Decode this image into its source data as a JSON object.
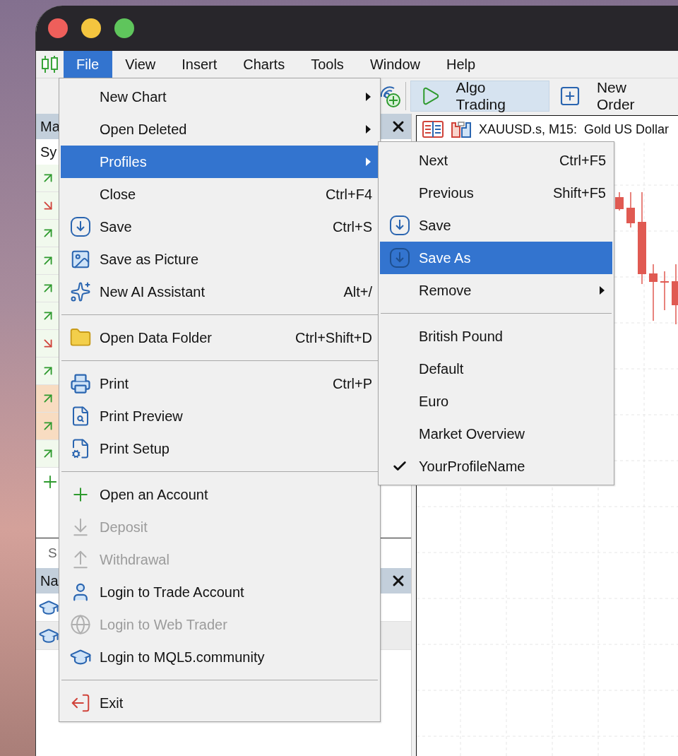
{
  "menu_bar": {
    "items": [
      {
        "label": "File",
        "selected": true
      },
      {
        "label": "View",
        "selected": false
      },
      {
        "label": "Insert",
        "selected": false
      },
      {
        "label": "Charts",
        "selected": false
      },
      {
        "label": "Tools",
        "selected": false
      },
      {
        "label": "Window",
        "selected": false
      },
      {
        "label": "Help",
        "selected": false
      }
    ]
  },
  "toolbar": {
    "buttons": [
      {
        "label": "Algo Trading",
        "active": true
      },
      {
        "label": "New Order",
        "active": false
      }
    ]
  },
  "market_watch": {
    "title": "Ma",
    "column": "Sy",
    "rows": [
      {
        "kind": "up",
        "highlighted": false
      },
      {
        "kind": "down",
        "highlighted": false
      },
      {
        "kind": "up",
        "highlighted": false
      },
      {
        "kind": "up",
        "highlighted": false
      },
      {
        "kind": "up",
        "highlighted": false
      },
      {
        "kind": "up",
        "highlighted": false
      },
      {
        "kind": "down",
        "highlighted": false
      },
      {
        "kind": "up",
        "highlighted": false
      },
      {
        "kind": "up",
        "highlighted": true
      },
      {
        "kind": "up",
        "highlighted": true
      },
      {
        "kind": "up",
        "highlighted": false
      }
    ]
  },
  "bottom_tab": "S",
  "navigator": {
    "title": "Na",
    "items": [
      {
        "selected": false
      },
      {
        "selected": true
      }
    ]
  },
  "chart": {
    "title": "XAUUSD.s, M15:  Gold US Dollar"
  },
  "file_menu": {
    "items": [
      {
        "kind": "item",
        "label": "New Chart",
        "submenu": true,
        "selected": false,
        "disabled": false
      },
      {
        "kind": "item",
        "label": "Open Deleted",
        "submenu": true,
        "selected": false,
        "disabled": false
      },
      {
        "kind": "item",
        "label": "Profiles",
        "submenu": true,
        "selected": true,
        "disabled": false
      },
      {
        "kind": "item",
        "label": "Close",
        "shortcut": "Ctrl+F4",
        "selected": false,
        "disabled": false
      },
      {
        "kind": "item",
        "label": "Save",
        "shortcut": "Ctrl+S",
        "selected": false,
        "disabled": false
      },
      {
        "kind": "item",
        "label": "Save as Picture",
        "selected": false,
        "disabled": false
      },
      {
        "kind": "item",
        "label": "New AI Assistant",
        "shortcut": "Alt+/",
        "selected": false,
        "disabled": false
      },
      {
        "kind": "separator"
      },
      {
        "kind": "item",
        "label": "Open Data Folder",
        "shortcut": "Ctrl+Shift+D",
        "selected": false,
        "disabled": false
      },
      {
        "kind": "separator"
      },
      {
        "kind": "item",
        "label": "Print",
        "shortcut": "Ctrl+P",
        "selected": false,
        "disabled": false
      },
      {
        "kind": "item",
        "label": "Print Preview",
        "selected": false,
        "disabled": false
      },
      {
        "kind": "item",
        "label": "Print Setup",
        "selected": false,
        "disabled": false
      },
      {
        "kind": "separator"
      },
      {
        "kind": "item",
        "label": "Open an Account",
        "selected": false,
        "disabled": false
      },
      {
        "kind": "item",
        "label": "Deposit",
        "selected": false,
        "disabled": true
      },
      {
        "kind": "item",
        "label": "Withdrawal",
        "selected": false,
        "disabled": true
      },
      {
        "kind": "item",
        "label": "Login to Trade Account",
        "selected": false,
        "disabled": false
      },
      {
        "kind": "item",
        "label": "Login to Web Trader",
        "selected": false,
        "disabled": true
      },
      {
        "kind": "item",
        "label": "Login to MQL5.community",
        "selected": false,
        "disabled": false
      },
      {
        "kind": "separator"
      },
      {
        "kind": "item",
        "label": "Exit",
        "selected": false,
        "disabled": false
      }
    ]
  },
  "profiles_menu": {
    "items": [
      {
        "kind": "item",
        "label": "Next",
        "shortcut": "Ctrl+F5",
        "selected": false,
        "checked": false
      },
      {
        "kind": "item",
        "label": "Previous",
        "shortcut": "Shift+F5",
        "selected": false,
        "checked": false
      },
      {
        "kind": "item",
        "label": "Save",
        "selected": false,
        "checked": false
      },
      {
        "kind": "item",
        "label": "Save As",
        "selected": true,
        "checked": false
      },
      {
        "kind": "item",
        "label": "Remove",
        "submenu": true,
        "selected": false,
        "checked": false
      },
      {
        "kind": "separator"
      },
      {
        "kind": "item",
        "label": "British Pound",
        "selected": false,
        "checked": false
      },
      {
        "kind": "item",
        "label": "Default",
        "selected": false,
        "checked": false
      },
      {
        "kind": "item",
        "label": "Euro",
        "selected": false,
        "checked": false
      },
      {
        "kind": "item",
        "label": "Market Overview",
        "selected": false,
        "checked": false
      },
      {
        "kind": "item",
        "label": "YourProfileName",
        "selected": false,
        "checked": true
      }
    ]
  }
}
